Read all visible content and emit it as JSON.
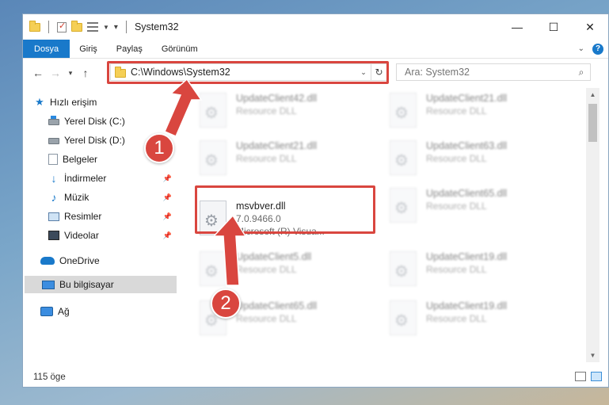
{
  "window": {
    "title": "System32",
    "controls": {
      "minimize": "—",
      "maximize": "☐",
      "close": "✕"
    }
  },
  "ribbon": {
    "tabs": [
      {
        "label": "Dosya",
        "active": true
      },
      {
        "label": "Giriş",
        "active": false
      },
      {
        "label": "Paylaş",
        "active": false
      },
      {
        "label": "Görünüm",
        "active": false
      }
    ],
    "help": "?"
  },
  "address": {
    "path": "C:\\Windows\\System32"
  },
  "search": {
    "placeholder": "Ara: System32"
  },
  "sidebar": {
    "items": [
      {
        "label": "Hızlı erişim",
        "icon": "star-icon"
      },
      {
        "label": "Yerel Disk (C:)",
        "icon": "drive-c-icon"
      },
      {
        "label": "Yerel Disk (D:)",
        "icon": "drive-d-icon"
      },
      {
        "label": "Belgeler",
        "icon": "documents-icon"
      },
      {
        "label": "İndirmeler",
        "icon": "downloads-icon",
        "pinned": true
      },
      {
        "label": "Müzik",
        "icon": "music-icon",
        "pinned": true
      },
      {
        "label": "Resimler",
        "icon": "pictures-icon",
        "pinned": true
      },
      {
        "label": "Videolar",
        "icon": "videos-icon",
        "pinned": true
      },
      {
        "label": "OneDrive",
        "icon": "onedrive-icon"
      },
      {
        "label": "Bu bilgisayar",
        "icon": "this-pc-icon",
        "selected": true
      },
      {
        "label": "Ağ",
        "icon": "network-icon"
      }
    ]
  },
  "files": [
    {
      "name": "UpdateClient42.dll",
      "sub1": "Resource DLL",
      "sub2": "",
      "blurred": true
    },
    {
      "name": "UpdateClient21.dll",
      "sub1": "Resource DLL",
      "sub2": "",
      "blurred": true
    },
    {
      "name": "UpdateClient21.dll",
      "sub1": "Resource DLL",
      "sub2": "",
      "blurred": true
    },
    {
      "name": "UpdateClient63.dll",
      "sub1": "Resource DLL",
      "sub2": "",
      "blurred": true
    },
    {
      "name": "msvbver.dll",
      "sub1": "7.0.9466.0",
      "sub2": "Microsoft (R) Visua...",
      "blurred": false
    },
    {
      "name": "UpdateClient65.dll",
      "sub1": "Resource DLL",
      "sub2": "",
      "blurred": true
    },
    {
      "name": "UpdateClient5.dll",
      "sub1": "Resource DLL",
      "sub2": "",
      "blurred": true
    },
    {
      "name": "UpdateClient19.dll",
      "sub1": "Resource DLL",
      "sub2": "",
      "blurred": true
    },
    {
      "name": "UpdateClient65.dll",
      "sub1": "Resource DLL",
      "sub2": "",
      "blurred": true
    },
    {
      "name": "UpdateClient19.dll",
      "sub1": "Resource DLL",
      "sub2": "",
      "blurred": true
    }
  ],
  "status": {
    "count": "115 öge"
  },
  "annotations": {
    "step1": "1",
    "step2": "2",
    "highlight_color": "#d9463f"
  }
}
